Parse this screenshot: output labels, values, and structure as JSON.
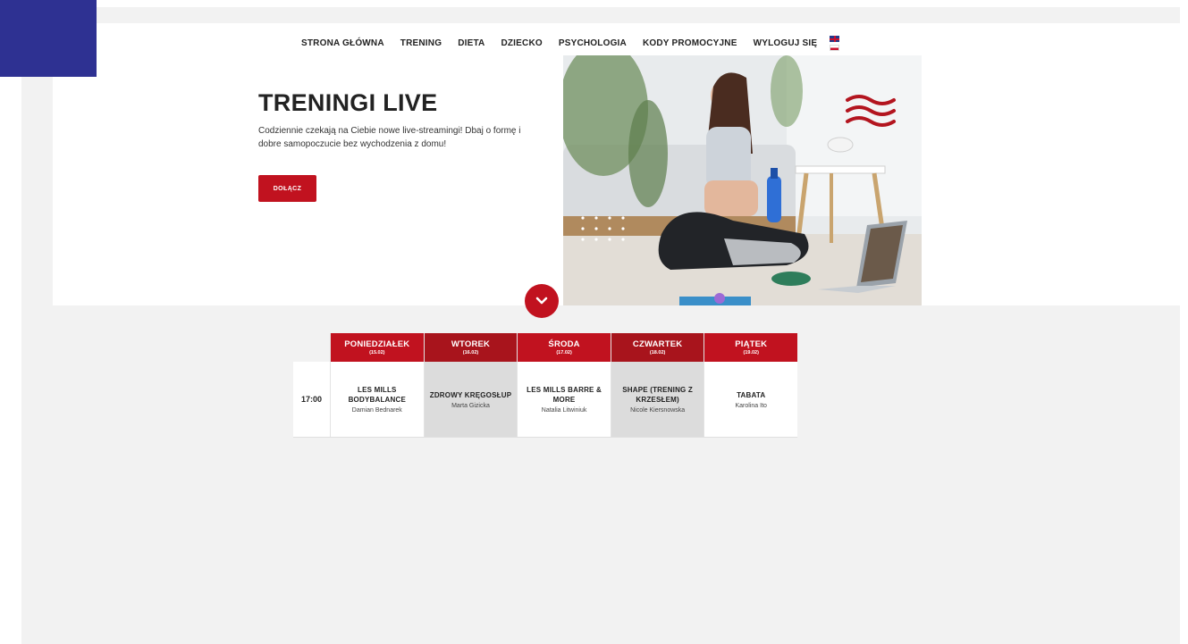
{
  "nav": {
    "items": [
      "STRONA GŁÓWNA",
      "TRENING",
      "DIETA",
      "DZIECKO",
      "PSYCHOLOGIA",
      "KODY PROMOCYJNE",
      "WYLOGUJ SIĘ"
    ]
  },
  "hero": {
    "title": "TRENINGI LIVE",
    "subtitle": "Codziennie czekają na Ciebie nowe live-streamingi! Dbaj o formę i dobre samopoczucie bez wychodzenia z domu!",
    "join_label": "DOŁĄCZ"
  },
  "schedule": {
    "days": [
      {
        "name": "PONIEDZIAŁEK",
        "date": "(15.02)"
      },
      {
        "name": "WTOREK",
        "date": "(16.02)"
      },
      {
        "name": "ŚRODA",
        "date": "(17.02)"
      },
      {
        "name": "CZWARTEK",
        "date": "(18.02)"
      },
      {
        "name": "PIĄTEK",
        "date": "(19.02)"
      }
    ],
    "time": "17:00",
    "classes": [
      {
        "name": "LES MILLS BODYBALANCE",
        "coach": "Damian Bednarek"
      },
      {
        "name": "ZDROWY KRĘGOSŁUP",
        "coach": "Marta Gizicka"
      },
      {
        "name": "LES MILLS BARRE & MORE",
        "coach": "Natalia Litwiniuk"
      },
      {
        "name": "SHAPE (TRENING Z KRZESŁEM)",
        "coach": "Nicole Kiersnowska"
      },
      {
        "name": "TABATA",
        "coach": "Karolina Ito"
      }
    ]
  },
  "colors": {
    "accent_red": "#c1121f",
    "brand_blue": "#2e3192",
    "page_bg": "#f2f2f2"
  },
  "icons": {
    "flags": [
      "uk-flag-icon",
      "pl-flag-icon"
    ],
    "scroll": "chevron-down-icon",
    "decor": "waves-icon"
  }
}
